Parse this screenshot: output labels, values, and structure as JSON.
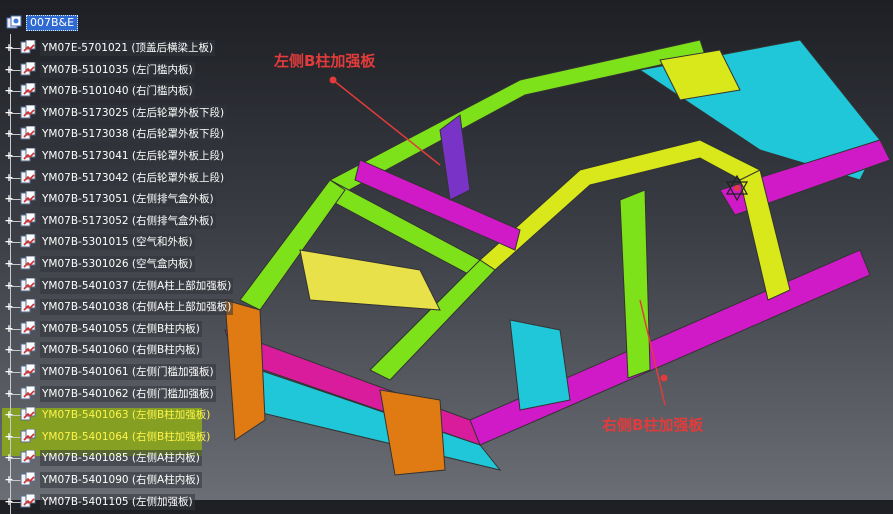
{
  "tree": {
    "root": "007B&E",
    "items": [
      {
        "label": "YM07E-5701021 (顶盖后横梁上板)"
      },
      {
        "label": "YM07B-5101035 (左门槛内板)"
      },
      {
        "label": "YM07B-5101040 (右门槛内板)"
      },
      {
        "label": "YM07B-5173025 (左后轮罩外板下段)"
      },
      {
        "label": "YM07B-5173038 (右后轮罩外板下段)"
      },
      {
        "label": "YM07B-5173041 (左后轮罩外板上段)"
      },
      {
        "label": "YM07B-5173042 (右后轮罩外板上段)"
      },
      {
        "label": "YM07B-5173051 (左侧排气盒外板)"
      },
      {
        "label": "YM07B-5173052 (右侧排气盒外板)"
      },
      {
        "label": "YM07B-5301015 (空气和外板)"
      },
      {
        "label": "YM07B-5301026 (空气盒内板)"
      },
      {
        "label": "YM07B-5401037 (左侧A柱上部加强板)"
      },
      {
        "label": "YM07B-5401038 (右侧A柱上部加强板)"
      },
      {
        "label": "YM07B-5401055 (左侧B柱内板)"
      },
      {
        "label": "YM07B-5401060 (右侧B柱内板)"
      },
      {
        "label": "YM07B-5401061 (左侧门槛加强板)"
      },
      {
        "label": "YM07B-5401062 (右侧门槛加强板)"
      },
      {
        "label": "YM07B-5401063 (左侧B柱加强板)",
        "highlighted": true
      },
      {
        "label": "YM07B-5401064 (右侧B柱加强板)",
        "highlighted": true
      },
      {
        "label": "YM07B-5401085 (左侧A柱内板)"
      },
      {
        "label": "YM07B-5401090 (右侧A柱内板)"
      },
      {
        "label": "YM07B-5401105 (左侧加强板)"
      }
    ]
  },
  "callouts": {
    "left": "左侧B柱加强板",
    "right": "右侧B柱加强板"
  },
  "colors": {
    "callout": "#e23b3b",
    "highlight": "#8aa61c",
    "selected": "#2f6ad0"
  }
}
